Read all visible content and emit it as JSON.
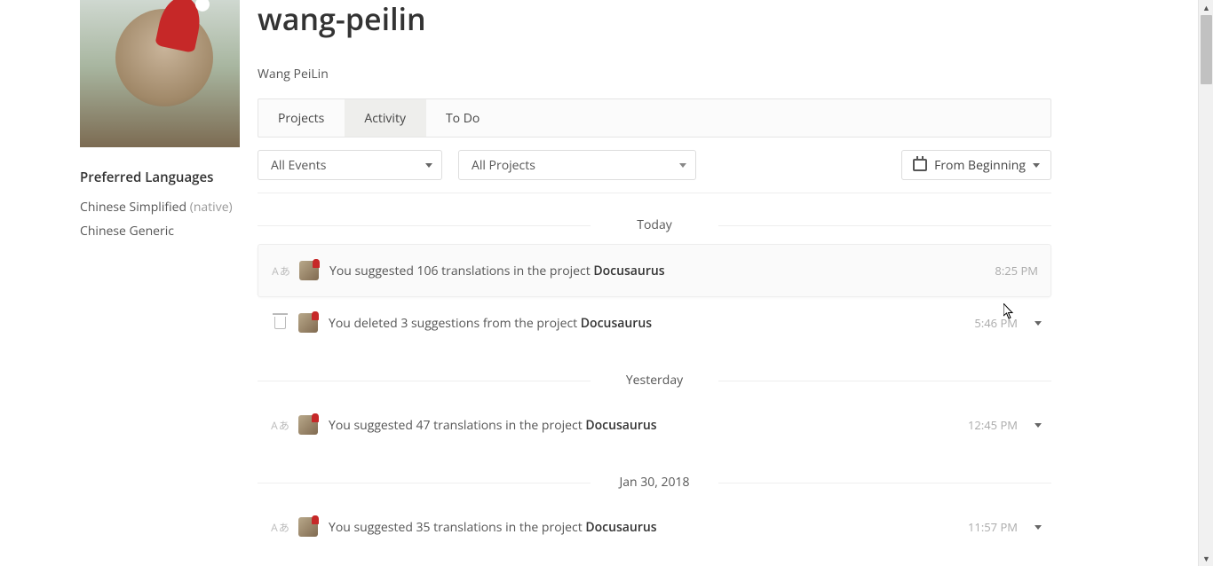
{
  "profile": {
    "username": "wang-peilin",
    "display_name": "Wang PeiLin"
  },
  "sidebar": {
    "pref_lang_heading": "Preferred Languages",
    "languages": [
      {
        "name": "Chinese Simplified",
        "native_tag": "(native)"
      },
      {
        "name": "Chinese Generic",
        "native_tag": ""
      }
    ]
  },
  "tabs": {
    "projects": "Projects",
    "activity": "Activity",
    "todo": "To Do"
  },
  "filters": {
    "events_selected": "All Events",
    "projects_selected": "All Projects",
    "date_range": "From Beginning"
  },
  "groups": [
    {
      "label": "Today",
      "items": [
        {
          "kind": "translate",
          "text_prefix": "You suggested 106 translations in the project ",
          "project": "Docusaurus",
          "time": "8:25 PM",
          "highlight": true,
          "expandable": false
        },
        {
          "kind": "delete",
          "text_prefix": "You deleted 3 suggestions from the project ",
          "project": "Docusaurus",
          "time": "5:46 PM",
          "highlight": false,
          "expandable": true
        }
      ]
    },
    {
      "label": "Yesterday",
      "items": [
        {
          "kind": "translate",
          "text_prefix": "You suggested 47 translations in the project ",
          "project": "Docusaurus",
          "time": "12:45 PM",
          "highlight": false,
          "expandable": true
        }
      ]
    },
    {
      "label": "Jan 30, 2018",
      "items": [
        {
          "kind": "translate",
          "text_prefix": "You suggested 35 translations in the project ",
          "project": "Docusaurus",
          "time": "11:57 PM",
          "highlight": false,
          "expandable": true
        }
      ]
    }
  ]
}
